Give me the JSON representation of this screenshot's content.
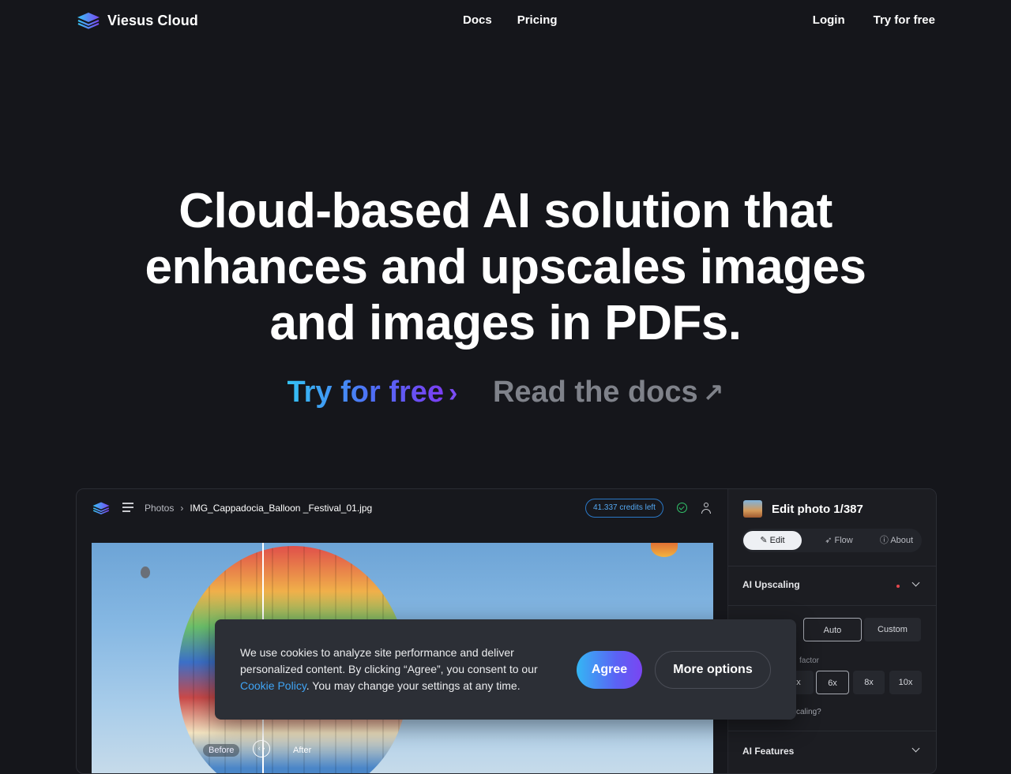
{
  "nav": {
    "brand": "Viesus Cloud",
    "links": [
      "Docs",
      "Pricing"
    ],
    "login": "Login",
    "try_free": "Try for free"
  },
  "hero": {
    "title_lines": [
      "Cloud-based AI solution that",
      "enhances and upscales images",
      "and images in PDFs."
    ],
    "cta_primary": "Try for free",
    "cta_primary_icon": "›",
    "cta_secondary": "Read the docs",
    "cta_secondary_icon": "↗"
  },
  "app": {
    "breadcrumb_root": "Photos",
    "breadcrumb_sep": "›",
    "breadcrumb_file": "IMG_Cappadocia_Balloon _Festival_01.jpg",
    "credits": "41.337 credits left",
    "before_label": "Before",
    "after_label": "After",
    "handle_icon": "‹ ›"
  },
  "panel": {
    "title": "Edit photo 1/387",
    "tabs": [
      "Edit",
      "Flow",
      "About"
    ],
    "section_upscaling": "AI Upscaling",
    "mode_options": [
      "Auto",
      "Custom"
    ],
    "factor_label": "factor",
    "factor_options": [
      "x",
      "6x",
      "8x",
      "10x"
    ],
    "question": "caling?",
    "section_features": "AI Features"
  },
  "cookie": {
    "text_before": "We use cookies to analyze site performance and deliver personalized content. By clicking “Agree”, you consent to our ",
    "link": "Cookie Policy",
    "text_after": ". You may change your settings at any time.",
    "agree": "Agree",
    "more": "More options"
  },
  "colors": {
    "background": "#15161b",
    "accent_blue": "#34c2f4",
    "accent_purple": "#7b3df2",
    "link": "#3fa4f5",
    "credits_border": "#2a78c7",
    "check_green": "#31c46b"
  }
}
